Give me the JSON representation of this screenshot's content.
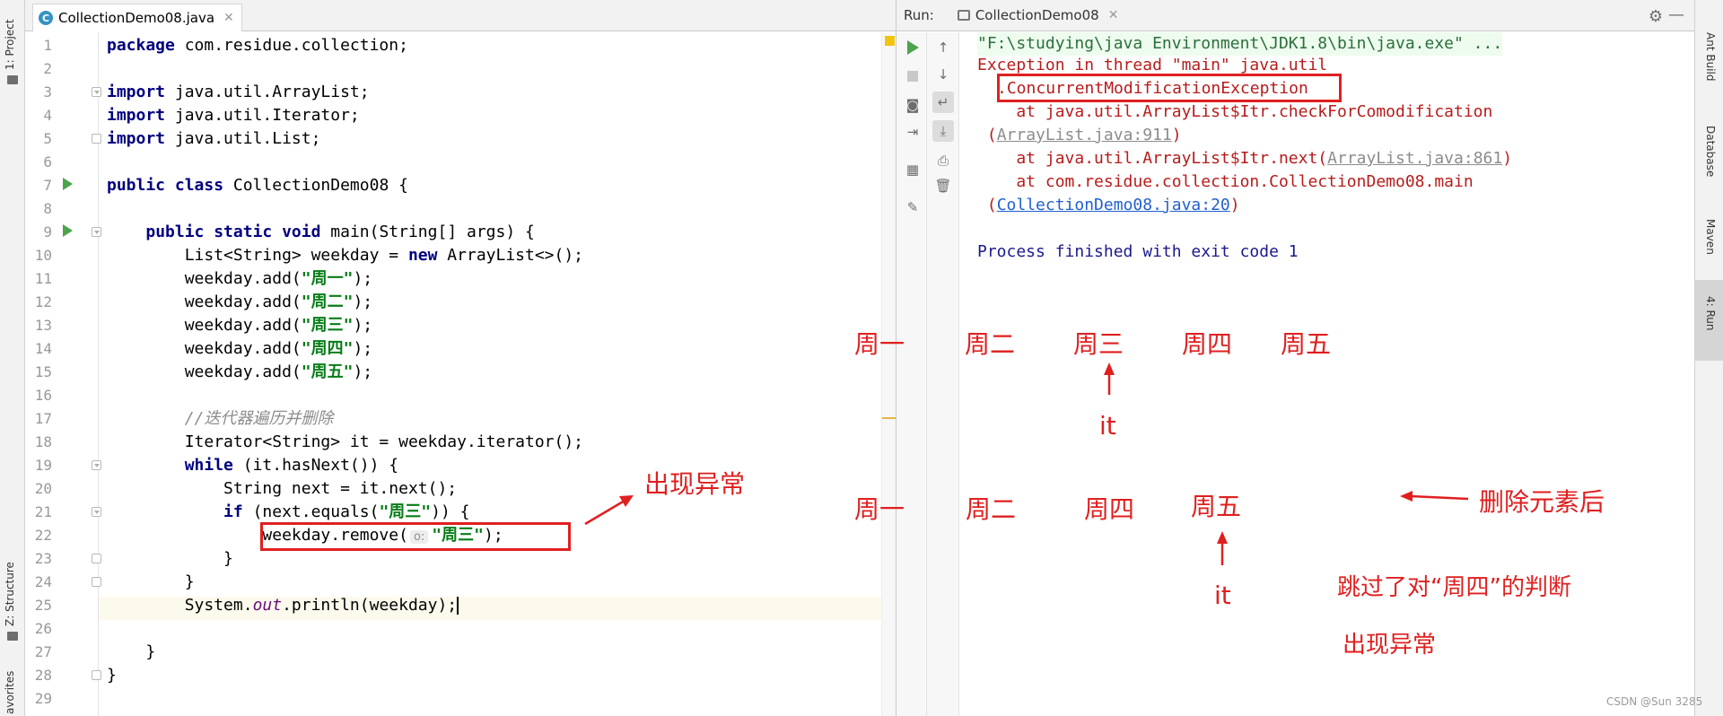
{
  "left_strip": {
    "project_tab": "1: Project",
    "structure_tab": "Z: Structure",
    "favorites_tab": "avorites"
  },
  "editor": {
    "tab_title": "CollectionDemo08.java",
    "line_numbers": [
      "1",
      "2",
      "3",
      "4",
      "5",
      "6",
      "7",
      "8",
      "9",
      "10",
      "11",
      "12",
      "13",
      "14",
      "15",
      "16",
      "17",
      "18",
      "19",
      "20",
      "21",
      "22",
      "23",
      "24",
      "25",
      "26",
      "27",
      "28",
      "29"
    ],
    "code": {
      "l1_kw": "package",
      "l1_rest": " com.residue.collection;",
      "l3_kw": "import",
      "l3_rest": " java.util.ArrayList;",
      "l4_kw": "import",
      "l4_rest": " java.util.Iterator;",
      "l5_kw": "import",
      "l5_rest": " java.util.List;",
      "l7_kw": "public class",
      "l7_rest": " CollectionDemo08 {",
      "l9_indent": "    ",
      "l9_kw": "public static void",
      "l9_rest": " main(String[] args) {",
      "l10_a": "        List<String> weekday = ",
      "l10_kw": "new",
      "l10_b": " ArrayList<>();",
      "l11_a": "        weekday.add(",
      "l11_str": "\"周一\"",
      "l11_b": ");",
      "l12_a": "        weekday.add(",
      "l12_str": "\"周二\"",
      "l12_b": ");",
      "l13_a": "        weekday.add(",
      "l13_str": "\"周三\"",
      "l13_b": ");",
      "l14_a": "        weekday.add(",
      "l14_str": "\"周四\"",
      "l14_b": ");",
      "l15_a": "        weekday.add(",
      "l15_str": "\"周五\"",
      "l15_b": ");",
      "l17_indent": "        ",
      "l17_cmt": "//迭代器遍历并删除",
      "l18": "        Iterator<String> it = weekday.iterator();",
      "l19_indent": "        ",
      "l19_kw": "while",
      "l19_rest": " (it.hasNext()) {",
      "l20": "            String next = it.next();",
      "l21_indent": "            ",
      "l21_kw": "if",
      "l21_a": " (next.equals(",
      "l21_str": "\"周三\"",
      "l21_b": ")) {",
      "l22_a": "                weekday.remove(",
      "l22_hint": "o:",
      "l22_str": "\"周三\"",
      "l22_b": ");",
      "l23": "            }",
      "l24": "        }",
      "l25_a": "        System.",
      "l25_field": "out",
      "l25_b": ".println(weekday);",
      "l27": "    }",
      "l28": "}"
    }
  },
  "run": {
    "label": "Run:",
    "tab_title": "CollectionDemo08",
    "console": {
      "cmd": "\"F:\\studying\\java Environment\\JDK1.8\\bin\\java.exe\" ...",
      "exc_line1": "Exception in thread \"main\" java.util",
      "exc_dot": ".",
      "exc_name": "ConcurrentModificationException",
      "at1": "    at java.util.ArrayList$Itr.checkForComodification",
      "at1_open": " (",
      "at1_link": "ArrayList.java:911",
      "at1_close": ")",
      "at2_a": "    at java.util.ArrayList$Itr.next(",
      "at2_link": "ArrayList.java:861",
      "at2_close": ")",
      "at3": "    at com.residue.collection.CollectionDemo08.main",
      "at3_open": " (",
      "at3_link": "CollectionDemo08.java:20",
      "at3_close": ")",
      "finished": "Process finished with exit code 1"
    }
  },
  "annotations": {
    "exception_note": "出现异常",
    "row1": [
      "周一",
      "周二",
      "周三",
      "周四",
      "周五"
    ],
    "row1_pointer": "it",
    "row2": [
      "周一",
      "周二",
      "周四",
      "周五"
    ],
    "row2_pointer": "it",
    "after_delete": "删除元素后",
    "skipped_note": "跳过了对“周四”的判断",
    "exception_note_2": "出现异常"
  },
  "right_strip": {
    "ant_tab": "Ant Build",
    "database_tab": "Database",
    "maven_tab": "Maven",
    "run_tab": "4: Run"
  },
  "watermark": "CSDN @Sun 3285",
  "colors": {
    "keyword": "#000080",
    "string": "#067d17",
    "annotation_red": "#e01f1f",
    "console_error": "#b71c1c",
    "run_green": "#4ca44c"
  },
  "icons": [
    "play-icon",
    "stop-icon",
    "camera-icon",
    "login-icon",
    "layout-icon",
    "pin-icon",
    "up-arrow-icon",
    "down-arrow-icon",
    "soft-wrap-icon",
    "scroll-end-icon",
    "print-icon",
    "trash-icon",
    "gear-icon",
    "minimize-icon"
  ]
}
